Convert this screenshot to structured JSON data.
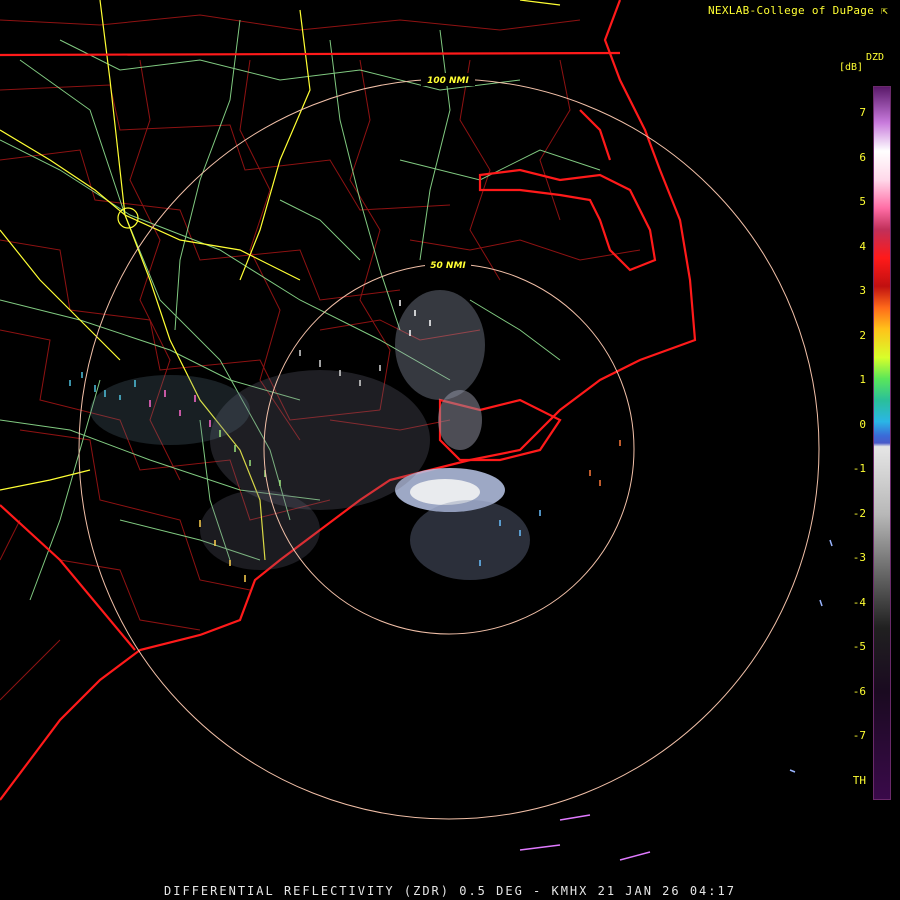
{
  "header": {
    "credit": "NEXLAB-College of DuPage ⇱"
  },
  "footer": {
    "caption": "DIFFERENTIAL REFLECTIVITY (ZDR) 0.5 DEG - KMHX 21 JAN 26 04:17"
  },
  "range_rings": {
    "inner_label": "50 NMI",
    "outer_label": "100 NMI"
  },
  "colorbar": {
    "product": "DZD",
    "units": "[dB]",
    "ticks": [
      "7",
      "6",
      "5",
      "4",
      "3",
      "2",
      "1",
      "0",
      "-1",
      "-2",
      "-3",
      "-4",
      "-5",
      "-6",
      "-7",
      "TH"
    ]
  },
  "colors": {
    "state_border": "#ff1a1a",
    "county_line": "#b01818",
    "highway": "#8fe08f",
    "interstate": "#ffff33",
    "range_ring": "#f2c0a8"
  }
}
